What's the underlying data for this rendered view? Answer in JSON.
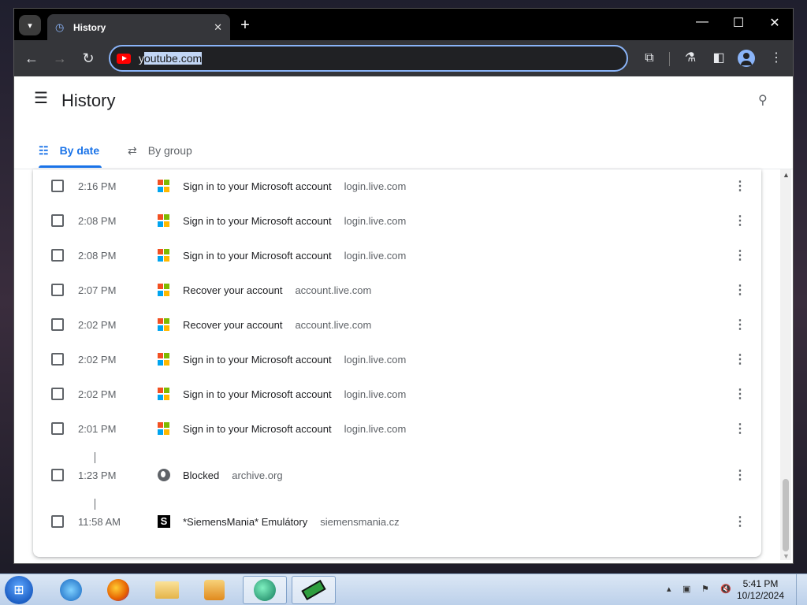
{
  "browser": {
    "tab_title": "History",
    "tab_close": "✕",
    "new_tab": "+",
    "url_first_char": "y",
    "url_selected": "outube.com",
    "window_minimize": "—",
    "window_maximize": "☐",
    "window_close": "✕"
  },
  "history_page": {
    "title": "History",
    "tabs": [
      {
        "label": "By date",
        "icon": "list-icon",
        "active": true
      },
      {
        "label": "By group",
        "icon": "group-icon",
        "active": false
      }
    ],
    "entries": [
      {
        "time": "2:16 PM",
        "title": "Sign in to your Microsoft account",
        "domain": "login.live.com",
        "favicon": "microsoft"
      },
      {
        "time": "2:08 PM",
        "title": "Sign in to your Microsoft account",
        "domain": "login.live.com",
        "favicon": "microsoft"
      },
      {
        "time": "2:08 PM",
        "title": "Sign in to your Microsoft account",
        "domain": "login.live.com",
        "favicon": "microsoft"
      },
      {
        "time": "2:07 PM",
        "title": "Recover your account",
        "domain": "account.live.com",
        "favicon": "microsoft"
      },
      {
        "time": "2:02 PM",
        "title": "Recover your account",
        "domain": "account.live.com",
        "favicon": "microsoft"
      },
      {
        "time": "2:02 PM",
        "title": "Sign in to your Microsoft account",
        "domain": "login.live.com",
        "favicon": "microsoft"
      },
      {
        "time": "2:02 PM",
        "title": "Sign in to your Microsoft account",
        "domain": "login.live.com",
        "favicon": "microsoft"
      },
      {
        "time": "2:01 PM",
        "title": "Sign in to your Microsoft account",
        "domain": "login.live.com",
        "favicon": "microsoft"
      },
      {
        "time": "1:23 PM",
        "title": "Blocked",
        "domain": "archive.org",
        "favicon": "globe"
      },
      {
        "time": "11:58 AM",
        "title": "*SiemensMania* Emulátory",
        "domain": "siemensmania.cz",
        "favicon": "siemensmania"
      }
    ]
  },
  "taskbar": {
    "clock_time": "5:41 PM",
    "clock_date": "10/12/2024"
  },
  "colors": {
    "accent": "#1a73e8",
    "ms_red": "#f25022",
    "ms_green": "#7fba00",
    "ms_blue": "#00a4ef",
    "ms_yellow": "#ffb900"
  }
}
